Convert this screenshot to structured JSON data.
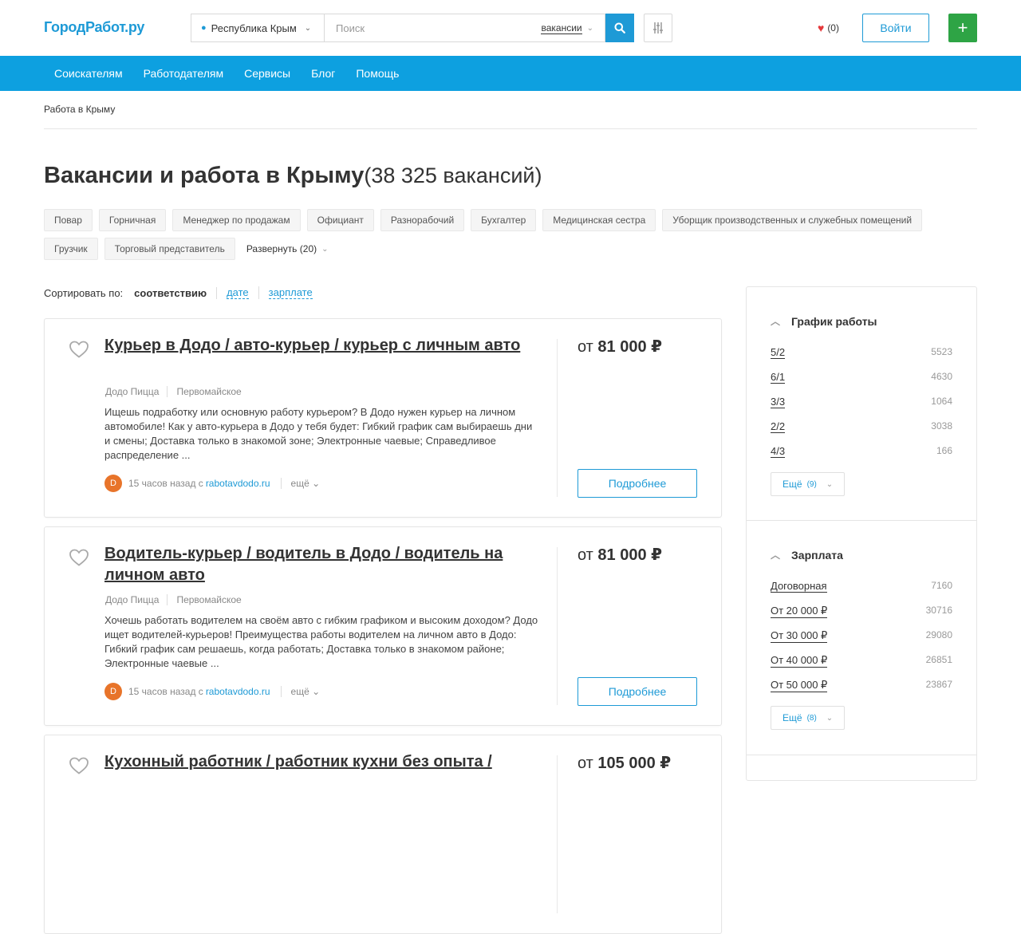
{
  "header": {
    "logo": "ГородРабот.ру",
    "region": "Республика Крым",
    "search_placeholder": "Поиск",
    "search_type": "вакансии",
    "favorites_count": "(0)",
    "login": "Войти",
    "add": "+"
  },
  "nav": [
    "Соискателям",
    "Работодателям",
    "Сервисы",
    "Блог",
    "Помощь"
  ],
  "breadcrumb": "Работа в Крыму",
  "page": {
    "title": "Вакансии и работа в Крыму",
    "count": "(38 325 вакансий)"
  },
  "tags": [
    "Повар",
    "Горничная",
    "Менеджер по продажам",
    "Официант",
    "Разнорабочий",
    "Бухгалтер",
    "Медицинская сестра",
    "Уборщик производственных и служебных помещений",
    "Грузчик",
    "Торговый представитель"
  ],
  "expand_label": "Развернуть (20)",
  "sort": {
    "label": "Сортировать по:",
    "current": "соответствию",
    "options": [
      "дате",
      "зарплате"
    ]
  },
  "vacancies": [
    {
      "title": "Курьер в Додо / авто-курьер / курьер с личным авто",
      "company": "Додо Пицца",
      "city": "Первомайское",
      "description": "Ищешь подработку или основную работу курьером? В Додо нужен курьер на личном автомобиле! Как у авто-курьера в Додо у тебя будет: Гибкий график сам выбираешь дни и смены; Доставка только в знакомой зоне; Электронные чаевые; Справедливое распределение ...",
      "posted": "15 часов назад с",
      "source": "rabotavdodo.ru",
      "more": "ещё",
      "salary_prefix": "от",
      "salary": "81 000",
      "currency": "₽",
      "detail": "Подробнее"
    },
    {
      "title": "Водитель-курьер / водитель в Додо / водитель на личном авто",
      "company": "Додо Пицца",
      "city": "Первомайское",
      "description": "Хочешь работать водителем на своём авто с гибким графиком и высоким доходом? Додо ищет водителей-курьеров! Преимущества работы водителем на личном авто в Додо: Гибкий график сам решаешь, когда работать; Доставка только в знакомом районе; Электронные чаевые ...",
      "posted": "15 часов назад с",
      "source": "rabotavdodo.ru",
      "more": "ещё",
      "salary_prefix": "от",
      "salary": "81 000",
      "currency": "₽",
      "detail": "Подробнее"
    },
    {
      "title": "Кухонный работник / работник кухни без опыта /",
      "salary_prefix": "от",
      "salary": "105 000",
      "currency": "₽"
    }
  ],
  "sidebar": {
    "schedule": {
      "title": "График работы",
      "items": [
        {
          "label": "5/2",
          "count": "5523"
        },
        {
          "label": "6/1",
          "count": "4630"
        },
        {
          "label": "3/3",
          "count": "1064"
        },
        {
          "label": "2/2",
          "count": "3038"
        },
        {
          "label": "4/3",
          "count": "166"
        }
      ],
      "more": "Ещё",
      "more_count": "(9)"
    },
    "salary": {
      "title": "Зарплата",
      "items": [
        {
          "label": "Договорная",
          "count": "7160"
        },
        {
          "label": "От 20 000 ₽",
          "count": "30716"
        },
        {
          "label": "От 30 000 ₽",
          "count": "29080"
        },
        {
          "label": "От 40 000 ₽",
          "count": "26851"
        },
        {
          "label": "От 50 000 ₽",
          "count": "23867"
        }
      ],
      "more": "Ещё",
      "more_count": "(8)"
    }
  }
}
